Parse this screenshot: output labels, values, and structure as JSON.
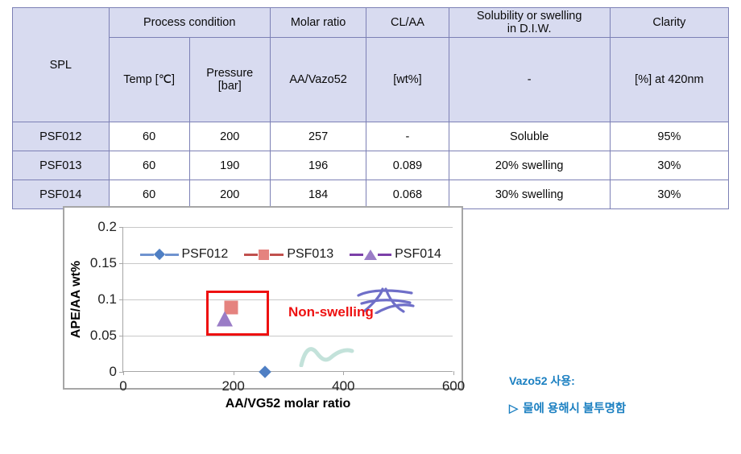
{
  "table": {
    "header_groups": {
      "spl": "SPL",
      "process_condition": "Process condition",
      "molar_ratio": "Molar ratio",
      "cl_aa": "CL/AA",
      "solubility": "Solubility or swelling\nin D.I.W.",
      "solubility_line1": "Solubility or swelling",
      "solubility_line2": "in D.I.W.",
      "clarity": "Clarity"
    },
    "subheaders": {
      "temp": "Temp [℃]",
      "pressure_line1": "Pressure",
      "pressure_line2": "[bar]",
      "molar_units": "AA/Vazo52",
      "cl_aa_units": "[wt%]",
      "solubility_units": "-",
      "clarity_units": "[%] at 420nm"
    },
    "rows": [
      {
        "spl": "PSF012",
        "temp": "60",
        "pressure": "200",
        "molar_ratio": "257",
        "cl_aa": "-",
        "solubility": "Soluble",
        "clarity": "95%"
      },
      {
        "spl": "PSF013",
        "temp": "60",
        "pressure": "190",
        "molar_ratio": "196",
        "cl_aa": "0.089",
        "solubility": "20% swelling",
        "clarity": "30%"
      },
      {
        "spl": "PSF014",
        "temp": "60",
        "pressure": "200",
        "molar_ratio": "184",
        "cl_aa": "0.068",
        "solubility": "30% swelling",
        "clarity": "30%"
      }
    ],
    "colors": {
      "header_fill": "#d8dbf0",
      "border": "#7c80b5"
    }
  },
  "chart_data": {
    "type": "scatter",
    "title": "",
    "xlabel": "AA/VG52 molar ratio",
    "ylabel": "APE/AA wt%",
    "xlim": [
      0,
      600
    ],
    "ylim": [
      0,
      0.2
    ],
    "xticks": [
      "0",
      "200",
      "400",
      "600"
    ],
    "xtick_values": [
      0,
      200,
      400,
      600
    ],
    "yticks": [
      "0",
      "0.05",
      "0.1",
      "0.15",
      "0.2"
    ],
    "ytick_values": [
      0,
      0.05,
      0.1,
      0.15,
      0.2
    ],
    "grid": "horizontal",
    "legend_position": "top-inside",
    "series": [
      {
        "name": "PSF012",
        "marker": "diamond",
        "color": "#4f7fc4",
        "line_color": "#6f93cf",
        "x": [
          257
        ],
        "y": [
          0
        ]
      },
      {
        "name": "PSF013",
        "marker": "square",
        "color": "#e5837f",
        "line_color": "#c0504d",
        "x": [
          196
        ],
        "y": [
          0.089
        ]
      },
      {
        "name": "PSF014",
        "marker": "triangle",
        "color": "#9a7cc6",
        "line_color": "#7b3fa8",
        "x": [
          184
        ],
        "y": [
          0.068
        ]
      }
    ],
    "annotations": [
      {
        "name": "non-swelling-label",
        "text": "Non-swelling",
        "color": "#ee1111",
        "x": 300,
        "y": 0.082
      },
      {
        "name": "highlight-box",
        "type": "rectangle",
        "color": "#ee1111",
        "x_range": [
          150,
          265
        ],
        "y_range": [
          0.05,
          0.112
        ]
      },
      {
        "name": "blue-scribble",
        "type": "freehand",
        "color": "#6f6fc8",
        "x_range": [
          425,
          510
        ],
        "y_range": [
          0.095,
          0.118
        ]
      },
      {
        "name": "green-scribble",
        "type": "freehand",
        "color": "#bfe0d8",
        "x_range": [
          320,
          415
        ],
        "y_range": [
          0.003,
          0.027
        ]
      }
    ]
  },
  "notes": {
    "line1": "Vazo52 사용:",
    "marker_glyph": "▷",
    "line2": "물에 용해시 불투명함",
    "color": "#1a7fc1"
  }
}
